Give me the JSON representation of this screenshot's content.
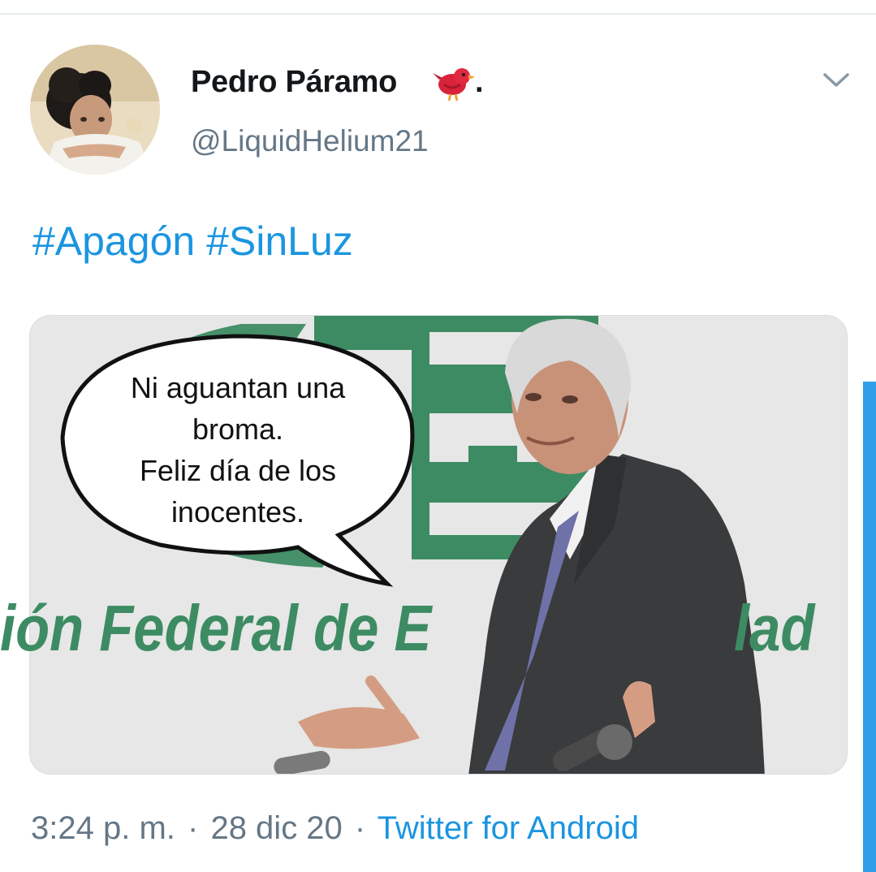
{
  "tweet": {
    "display_name": "Pedro Páramo",
    "name_suffix": ".",
    "handle": "@LiquidHelium21",
    "hashtags": [
      "#Apagón",
      "#SinLuz"
    ],
    "timestamp_time": "3:24 p. m.",
    "timestamp_date": "28 dic 20",
    "separator": "·",
    "source": "Twitter for Android"
  },
  "media": {
    "speech_bubble_lines": [
      "Ni aguantan una",
      "broma.",
      "Feliz día de los",
      "inocentes."
    ],
    "banner_text_left": "ión Federal de E",
    "banner_text_right": "lad"
  },
  "icons": {
    "more": "chevron-down-icon",
    "name_emoji": "red-bird-emoji"
  },
  "colors": {
    "link": "#1b95e0",
    "secondary_text": "#657786",
    "primary_text": "#14171a",
    "cfe_green": "#3d8b63",
    "scrollbar": "#2f9fe9"
  }
}
